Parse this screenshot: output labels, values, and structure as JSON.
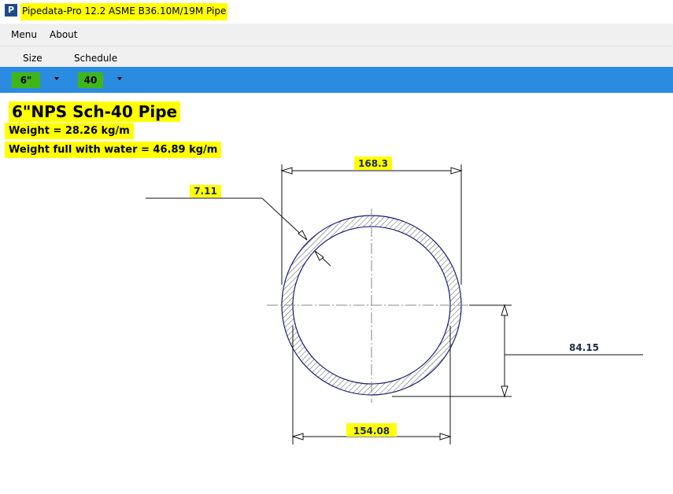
{
  "window": {
    "title": "Pipedata-Pro 12.2 ASME B36.10M/19M Pipe",
    "icon_letter": "P"
  },
  "menu": {
    "items": [
      "Menu",
      "About"
    ]
  },
  "selectors": {
    "size_label": "Size",
    "schedule_label": "Schedule",
    "size_value": "6\"",
    "schedule_value": "40"
  },
  "result": {
    "heading": "6\"NPS  Sch-40 Pipe",
    "weight": "Weight =  28.26 kg/m",
    "weight_full": "Weight full with water =  46.89 kg/m"
  },
  "drawing": {
    "outside_diameter": "168.3",
    "wall_thickness": "7.11",
    "inside_diameter": "154.08",
    "inside_radius": "84.15"
  },
  "colors": {
    "highlight": "#ffff00",
    "toolbar": "#2b8be0",
    "selected_value": "#3fb618",
    "dimension_text": "#1a2a4a"
  }
}
